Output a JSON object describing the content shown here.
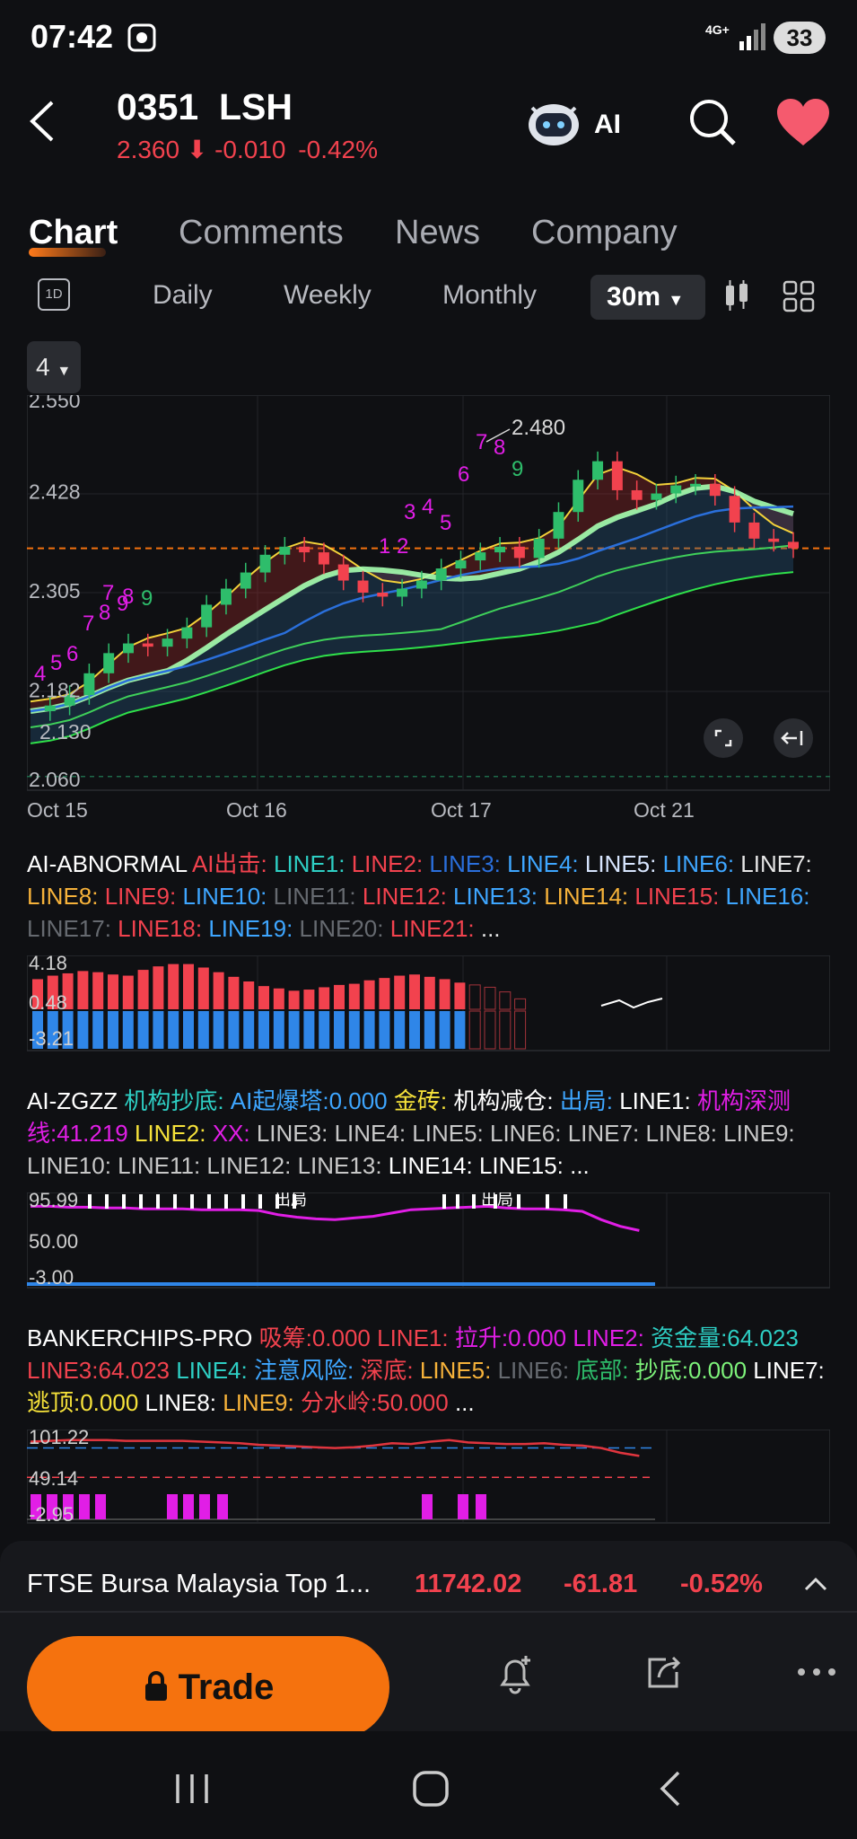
{
  "status": {
    "time": "07:42",
    "network": "4G+",
    "battery": "33"
  },
  "header": {
    "symbol": "0351",
    "name": "LSH",
    "price": "2.360",
    "change": "-0.010",
    "change_pct": "-0.42%",
    "ai_label": "AI"
  },
  "tabs": [
    {
      "label": "Chart"
    },
    {
      "label": "Comments"
    },
    {
      "label": "News"
    },
    {
      "label": "Company"
    }
  ],
  "periods": {
    "oneday": "1D",
    "daily": "Daily",
    "weekly": "Weekly",
    "monthly": "Monthly",
    "selected": "30m"
  },
  "indicator_chip": "4",
  "colors": {
    "up": "#2ebd6b",
    "down": "#f2424e",
    "accent": "#f5720e",
    "magenta": "#e11ee6"
  },
  "chart_data": [
    {
      "type": "candlestick",
      "y_ticks": [
        "2.550",
        "2.428",
        "2.305",
        "2.182",
        "2.130",
        "2.060"
      ],
      "ylim": [
        2.06,
        2.55
      ],
      "x_labels": [
        "Oct 15",
        "Oct 16",
        "Oct 17",
        "Oct 21"
      ],
      "annotations": {
        "high": "2.480",
        "counts": [
          "7",
          "8",
          "9",
          "1",
          "2",
          "3",
          "4",
          "5",
          "6",
          "7",
          "8",
          "9",
          "4",
          "5",
          "6",
          "7",
          "8",
          "9"
        ]
      },
      "current_price": 2.36
    },
    {
      "type": "bar",
      "title": "AI-ABNORMAL",
      "y_ticks": [
        "4.18",
        "0.48",
        "-3.21"
      ],
      "legend": [
        {
          "text": "AI-ABNORMAL",
          "color": "#ffffff"
        },
        {
          "text": "AI出击:",
          "color": "#f2424e"
        },
        {
          "text": "LINE1:",
          "color": "#2ecfc4"
        },
        {
          "text": "LINE2:",
          "color": "#f2424e"
        },
        {
          "text": "LINE3:",
          "color": "#2a6fdb"
        },
        {
          "text": "LINE4:",
          "color": "#3ea6ff"
        },
        {
          "text": "LINE5:",
          "color": "#d8e6ff"
        },
        {
          "text": "LINE6:",
          "color": "#3ea6ff"
        },
        {
          "text": "LINE7:",
          "color": "#e6e6e6"
        },
        {
          "text": "LINE8:",
          "color": "#f6b23a"
        },
        {
          "text": "LINE9:",
          "color": "#f2424e"
        },
        {
          "text": "LINE10:",
          "color": "#3ea6ff"
        },
        {
          "text": "LINE11:",
          "color": "#666a70"
        },
        {
          "text": "LINE12:",
          "color": "#f2424e"
        },
        {
          "text": "LINE13:",
          "color": "#3ea6ff"
        },
        {
          "text": "LINE14:",
          "color": "#f6b23a"
        },
        {
          "text": "LINE15:",
          "color": "#f2424e"
        },
        {
          "text": "LINE16:",
          "color": "#3ea6ff"
        },
        {
          "text": "LINE17:",
          "color": "#666a70"
        },
        {
          "text": "LINE18:",
          "color": "#f2424e"
        },
        {
          "text": "LINE19:",
          "color": "#3ea6ff"
        },
        {
          "text": "LINE20:",
          "color": "#666a70"
        },
        {
          "text": "LINE21:",
          "color": "#f2424e"
        },
        {
          "text": "...",
          "color": "#e6e6e6"
        }
      ],
      "values": [
        2.6,
        2.9,
        3.1,
        3.3,
        3.2,
        3.0,
        2.9,
        3.4,
        3.7,
        3.9,
        3.9,
        3.6,
        3.2,
        2.8,
        2.4,
        2.0,
        1.8,
        1.6,
        1.7,
        1.9,
        2.1,
        2.2,
        2.5,
        2.7,
        2.9,
        3.0,
        2.8,
        2.6,
        2.3,
        2.1,
        1.9,
        1.5,
        0.9
      ]
    },
    {
      "type": "line",
      "title": "AI-ZGZZ",
      "y_ticks": [
        "95.99",
        "50.00",
        "-3.00"
      ],
      "marks": [
        "出局",
        "出局"
      ],
      "legend": [
        {
          "text": "AI-ZGZZ",
          "color": "#ffffff"
        },
        {
          "text": "机构抄底:",
          "color": "#2ecfc4"
        },
        {
          "text": "AI起爆塔:0.000",
          "color": "#3ea6ff"
        },
        {
          "text": "金砖:",
          "color": "#f6e23a"
        },
        {
          "text": "机构减仓:",
          "color": "#ffffff"
        },
        {
          "text": "出局:",
          "color": "#3ea6ff"
        },
        {
          "text": "LINE1:",
          "color": "#ffffff"
        },
        {
          "text": "机构深测线:41.219",
          "color": "#e11ee6"
        },
        {
          "text": "LINE2:",
          "color": "#f6e23a"
        },
        {
          "text": "XX:",
          "color": "#e11ee6"
        },
        {
          "text": "LINE3:",
          "color": "#c8c8c8"
        },
        {
          "text": "LINE4:",
          "color": "#c8c8c8"
        },
        {
          "text": "LINE5:",
          "color": "#c8c8c8"
        },
        {
          "text": "LINE6:",
          "color": "#c8c8c8"
        },
        {
          "text": "LINE7:",
          "color": "#c8c8c8"
        },
        {
          "text": "LINE8:",
          "color": "#c8c8c8"
        },
        {
          "text": "LINE9:",
          "color": "#c8c8c8"
        },
        {
          "text": "LINE10:",
          "color": "#c8c8c8"
        },
        {
          "text": "LINE11:",
          "color": "#c8c8c8"
        },
        {
          "text": "LINE12:",
          "color": "#c8c8c8"
        },
        {
          "text": "LINE13:",
          "color": "#c8c8c8"
        },
        {
          "text": "LINE14:",
          "color": "#ffffff"
        },
        {
          "text": "LINE15:",
          "color": "#ffffff"
        },
        {
          "text": "...",
          "color": "#ffffff"
        }
      ],
      "values": [
        88,
        88,
        87,
        87,
        86,
        86,
        85,
        85,
        85,
        84,
        84,
        84,
        83,
        78,
        75,
        73,
        72,
        74,
        76,
        80,
        84,
        85,
        86,
        87,
        88,
        86,
        85,
        85,
        84,
        82,
        72,
        64,
        59
      ]
    },
    {
      "type": "line",
      "title": "BANKERCHIPS-PRO",
      "y_ticks": [
        "101.22",
        "49.14",
        "-2.95"
      ],
      "legend": [
        {
          "text": "BANKERCHIPS-PRO",
          "color": "#ffffff"
        },
        {
          "text": "吸筹:0.000",
          "color": "#f2424e"
        },
        {
          "text": "LINE1:",
          "color": "#f2424e"
        },
        {
          "text": "拉升:0.000",
          "color": "#e11ee6"
        },
        {
          "text": "LINE2:",
          "color": "#e11ee6"
        },
        {
          "text": "资金量:64.023",
          "color": "#2ecfc4"
        },
        {
          "text": "LINE3:64.023",
          "color": "#f2424e"
        },
        {
          "text": "LINE4:",
          "color": "#2ecfc4"
        },
        {
          "text": "注意风险:",
          "color": "#3ea6ff"
        },
        {
          "text": "深底:",
          "color": "#f2424e"
        },
        {
          "text": "LINE5:",
          "color": "#f6b23a"
        },
        {
          "text": "LINE6:",
          "color": "#666a70"
        },
        {
          "text": "底部:",
          "color": "#2ebd6b"
        },
        {
          "text": "抄底:0.000",
          "color": "#7df27a"
        },
        {
          "text": "LINE7:",
          "color": "#ffffff"
        },
        {
          "text": "逃顶:0.000",
          "color": "#f6e23a"
        },
        {
          "text": "LINE8:",
          "color": "#ffffff"
        },
        {
          "text": "LINE9:",
          "color": "#f6b23a"
        },
        {
          "text": "分水岭:50.000",
          "color": "#f2424e"
        },
        {
          "text": "...",
          "color": "#ffffff"
        }
      ],
      "values": [
        95,
        96,
        97,
        97,
        97,
        96,
        96,
        96,
        96,
        95,
        94,
        93,
        91,
        90,
        89,
        88,
        87,
        88,
        90,
        93,
        92,
        95,
        97,
        94,
        93,
        92,
        92,
        93,
        91,
        90,
        87,
        81,
        77
      ]
    }
  ],
  "market_ticker": {
    "name": "FTSE Bursa Malaysia Top 1...",
    "value": "11742.02",
    "change": "-61.81",
    "change_pct": "-0.52%"
  },
  "actions": {
    "trade_label": "Trade"
  }
}
